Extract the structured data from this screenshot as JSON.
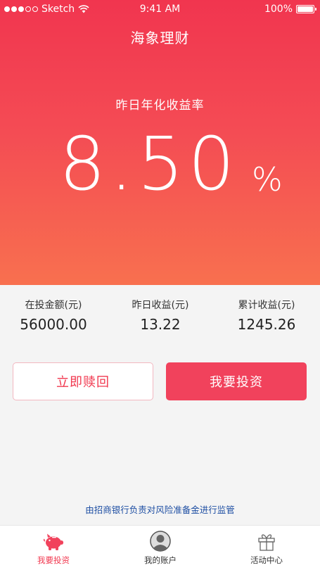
{
  "status_bar": {
    "carrier": "Sketch",
    "time": "9:41 AM",
    "battery": "100%",
    "signal_dots": 5,
    "signal_filled": 3
  },
  "header": {
    "title": "海象理财"
  },
  "hero": {
    "rate_label": "昨日年化收益率",
    "rate_value": "8.50",
    "rate_unit": "%"
  },
  "stats": [
    {
      "label": "在投金额(元)",
      "value": "56000.00"
    },
    {
      "label": "昨日收益(元)",
      "value": "13.22"
    },
    {
      "label": "累计收益(元)",
      "value": "1245.26"
    }
  ],
  "actions": {
    "redeem_label": "立即赎回",
    "invest_label": "我要投资"
  },
  "footer_note": "由招商银行负责对风险准备金进行监管",
  "tabbar": {
    "items": [
      {
        "label": "我要投资",
        "icon": "piggy-bank-icon",
        "active": true
      },
      {
        "label": "我的账户",
        "icon": "user-avatar-icon",
        "active": false
      },
      {
        "label": "活动中心",
        "icon": "gift-icon",
        "active": false
      }
    ]
  },
  "colors": {
    "accent": "#f1425c",
    "hero_top": "#f1354f",
    "hero_bottom": "#f8704f",
    "link": "#1f4fa3"
  }
}
